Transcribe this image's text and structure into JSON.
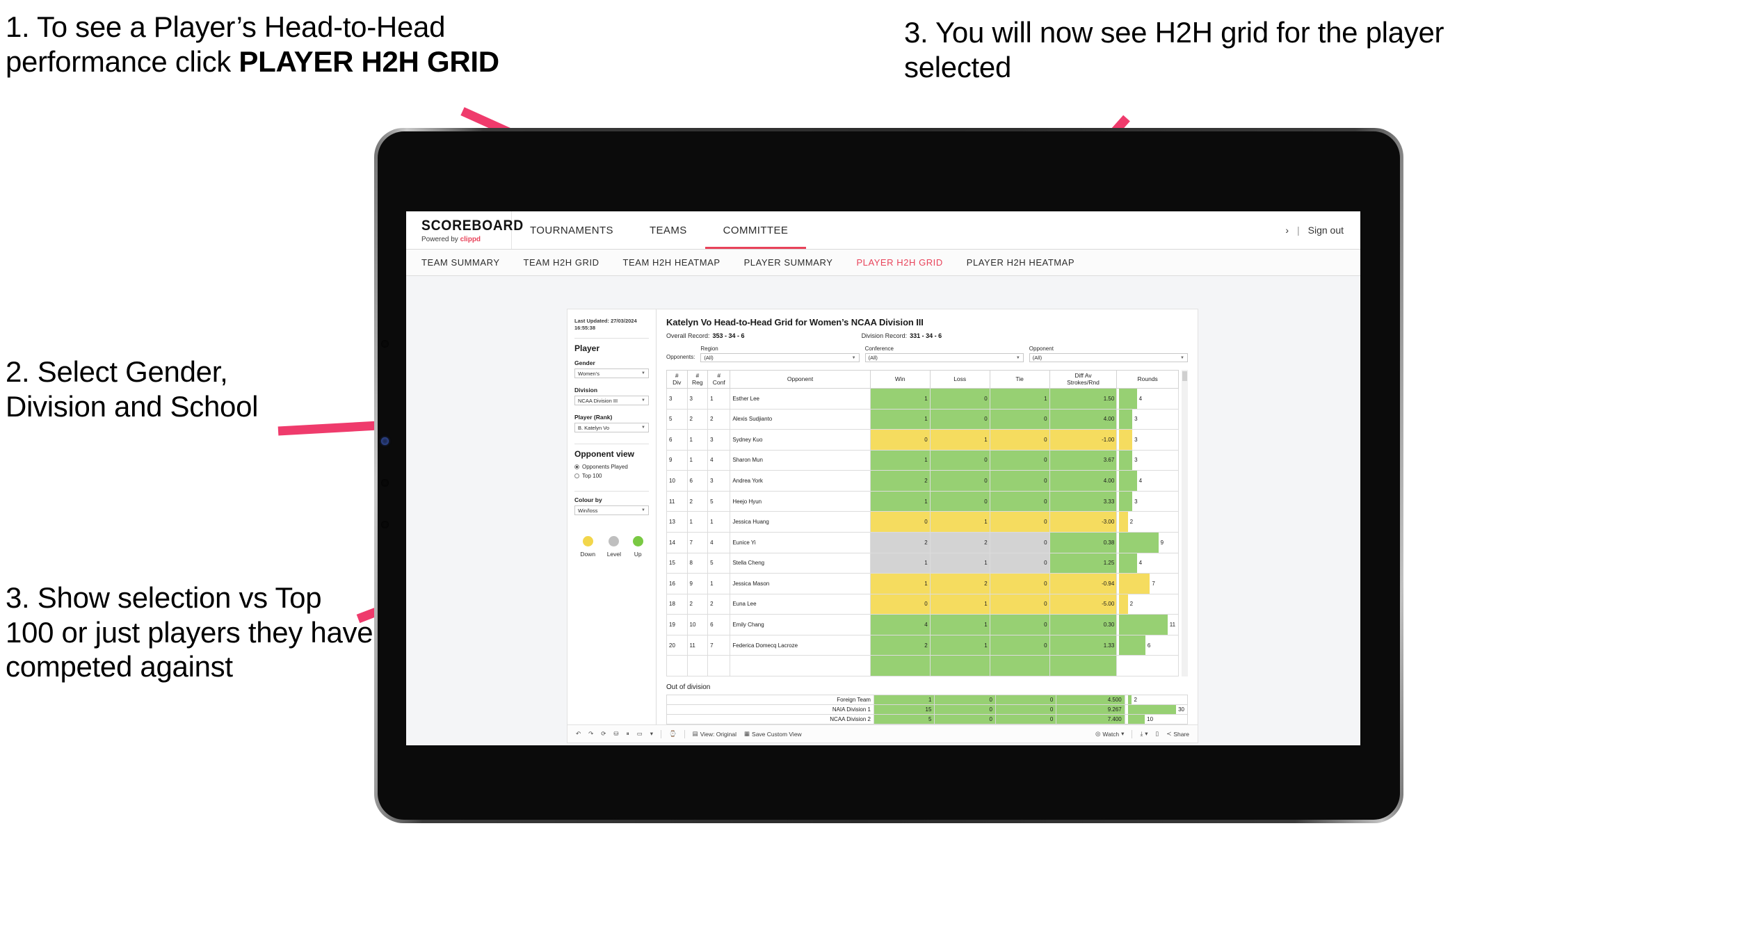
{
  "annotations": {
    "step1_prefix": "1. To see a Player’s Head-to-Head performance click ",
    "step1_bold": "PLAYER H2H GRID",
    "step2": "2. Select Gender, Division and School",
    "step3_left": "3. Show selection vs Top 100 or just players they have competed against",
    "step3_right": "3. You will now see H2H grid for the player selected",
    "arrow_color": "#ef3b6c"
  },
  "app": {
    "brand": {
      "title": "SCOREBOARD",
      "powered_prefix": "Powered by ",
      "powered_brand": "clippd"
    },
    "top_nav": [
      {
        "label": "TOURNAMENTS",
        "active": false
      },
      {
        "label": "TEAMS",
        "active": false
      },
      {
        "label": "COMMITTEE",
        "active": true
      }
    ],
    "top_right": {
      "chevron": "›",
      "separator": "|",
      "sign_out": "Sign out"
    },
    "sub_nav": [
      {
        "label": "TEAM SUMMARY",
        "active": false
      },
      {
        "label": "TEAM H2H GRID",
        "active": false
      },
      {
        "label": "TEAM H2H HEATMAP",
        "active": false
      },
      {
        "label": "PLAYER SUMMARY",
        "active": false
      },
      {
        "label": "PLAYER H2H GRID",
        "active": true
      },
      {
        "label": "PLAYER H2H HEATMAP",
        "active": false
      }
    ],
    "accent_color": "#e8435a"
  },
  "panel": {
    "last_updated": "Last Updated: 27/03/2024 16:55:38",
    "heading": "Player",
    "fields": [
      {
        "label": "Gender",
        "value": "Women’s"
      },
      {
        "label": "Division",
        "value": "NCAA Division III"
      },
      {
        "label": "Player (Rank)",
        "value": "B. Katelyn Vo"
      }
    ],
    "opponent_view": {
      "heading": "Opponent view",
      "options": [
        {
          "label": "Opponents Played",
          "selected": true
        },
        {
          "label": "Top 100",
          "selected": false
        }
      ]
    },
    "colour_by": {
      "label": "Colour by",
      "value": "Win/loss"
    },
    "legend": [
      {
        "label": "Down",
        "color": "#f2d64b"
      },
      {
        "label": "Level",
        "color": "#bfbfbf"
      },
      {
        "label": "Up",
        "color": "#7ac943"
      }
    ]
  },
  "viz": {
    "title": "Katelyn Vo Head-to-Head Grid for Women’s NCAA Division III",
    "overall_record_label": "Overall Record:",
    "overall_record_value": "353 -  34 - 6",
    "division_record_label": "Division Record:",
    "division_record_value": "331 -  34 - 6",
    "opponents_label": "Opponents:",
    "filters": [
      {
        "label": "Region",
        "value": "(All)"
      },
      {
        "label": "Conference",
        "value": "(All)"
      },
      {
        "label": "Opponent",
        "value": "(All)"
      }
    ]
  },
  "chart_data": {
    "type": "table",
    "title": "Katelyn Vo Head-to-Head Grid for Women’s NCAA Division III",
    "columns": [
      "# Div",
      "# Reg",
      "# Conf",
      "Opponent",
      "Win",
      "Loss",
      "Tie",
      "Diff Av Strokes/Rnd",
      "Rounds"
    ],
    "column_headers_two_line": [
      {
        "l1": "#",
        "l2": "Div"
      },
      {
        "l1": "#",
        "l2": "Reg"
      },
      {
        "l1": "#",
        "l2": "Conf"
      },
      {
        "l1": "Opponent",
        "l2": ""
      },
      {
        "l1": "Win",
        "l2": ""
      },
      {
        "l1": "Loss",
        "l2": ""
      },
      {
        "l1": "Tie",
        "l2": ""
      },
      {
        "l1": "Diff Av",
        "l2": "Strokes/Rnd"
      },
      {
        "l1": "Rounds",
        "l2": ""
      }
    ],
    "rows": [
      {
        "div": "3",
        "reg": "3",
        "conf": "1",
        "opponent": "Esther Lee",
        "win": "1",
        "loss": "0",
        "tie": "1",
        "diff": "1.50",
        "rounds": "4",
        "color": "g",
        "bar_pct": 31
      },
      {
        "div": "5",
        "reg": "2",
        "conf": "2",
        "opponent": "Alexis Sudjianto",
        "win": "1",
        "loss": "0",
        "tie": "0",
        "diff": "4.00",
        "rounds": "3",
        "color": "g",
        "bar_pct": 23
      },
      {
        "div": "6",
        "reg": "1",
        "conf": "3",
        "opponent": "Sydney Kuo",
        "win": "0",
        "loss": "1",
        "tie": "0",
        "diff": "-1.00",
        "rounds": "3",
        "color": "y",
        "bar_pct": 23
      },
      {
        "div": "9",
        "reg": "1",
        "conf": "4",
        "opponent": "Sharon Mun",
        "win": "1",
        "loss": "0",
        "tie": "0",
        "diff": "3.67",
        "rounds": "3",
        "color": "g",
        "bar_pct": 23
      },
      {
        "div": "10",
        "reg": "6",
        "conf": "3",
        "opponent": "Andrea York",
        "win": "2",
        "loss": "0",
        "tie": "0",
        "diff": "4.00",
        "rounds": "4",
        "color": "g",
        "bar_pct": 31
      },
      {
        "div": "11",
        "reg": "2",
        "conf": "5",
        "opponent": "Heejo Hyun",
        "win": "1",
        "loss": "0",
        "tie": "0",
        "diff": "3.33",
        "rounds": "3",
        "color": "g",
        "bar_pct": 23
      },
      {
        "div": "13",
        "reg": "1",
        "conf": "1",
        "opponent": "Jessica Huang",
        "win": "0",
        "loss": "1",
        "tie": "0",
        "diff": "-3.00",
        "rounds": "2",
        "color": "y",
        "bar_pct": 15
      },
      {
        "div": "14",
        "reg": "7",
        "conf": "4",
        "opponent": "Eunice Yi",
        "win": "2",
        "loss": "2",
        "tie": "0",
        "diff": "0.38",
        "rounds": "9",
        "color": "n",
        "diff_color": "g",
        "bar_pct": 69
      },
      {
        "div": "15",
        "reg": "8",
        "conf": "5",
        "opponent": "Stella Cheng",
        "win": "1",
        "loss": "1",
        "tie": "0",
        "diff": "1.25",
        "rounds": "4",
        "color": "n",
        "diff_color": "g",
        "bar_pct": 31
      },
      {
        "div": "16",
        "reg": "9",
        "conf": "1",
        "opponent": "Jessica Mason",
        "win": "1",
        "loss": "2",
        "tie": "0",
        "diff": "-0.94",
        "rounds": "7",
        "color": "y",
        "bar_pct": 54
      },
      {
        "div": "18",
        "reg": "2",
        "conf": "2",
        "opponent": "Euna Lee",
        "win": "0",
        "loss": "1",
        "tie": "0",
        "diff": "-5.00",
        "rounds": "2",
        "color": "y",
        "bar_pct": 15
      },
      {
        "div": "19",
        "reg": "10",
        "conf": "6",
        "opponent": "Emily Chang",
        "win": "4",
        "loss": "1",
        "tie": "0",
        "diff": "0.30",
        "rounds": "11",
        "color": "g",
        "bar_pct": 85
      },
      {
        "div": "20",
        "reg": "11",
        "conf": "7",
        "opponent": "Federica Domecq Lacroze",
        "win": "2",
        "loss": "1",
        "tie": "0",
        "diff": "1.33",
        "rounds": "6",
        "color": "g",
        "bar_pct": 46
      }
    ],
    "out_of_division": {
      "title": "Out of division",
      "rows": [
        {
          "label": "Foreign Team",
          "win": "1",
          "loss": "0",
          "tie": "0",
          "diff": "4.500",
          "rounds": "2",
          "color": "g",
          "bar_pct": 7
        },
        {
          "label": "NAIA Division 1",
          "win": "15",
          "loss": "0",
          "tie": "0",
          "diff": "9.267",
          "rounds": "30",
          "color": "g",
          "bar_pct": 90
        },
        {
          "label": "NCAA Division 2",
          "win": "5",
          "loss": "0",
          "tie": "0",
          "diff": "7.400",
          "rounds": "10",
          "color": "g",
          "bar_pct": 30
        }
      ]
    },
    "colors": {
      "up": "#97d073",
      "down": "#f5dc5f",
      "level": "#d3d3d3"
    }
  },
  "toolbar": {
    "undo_icon": "↶",
    "redo_icon": "↷",
    "revert_icon": "⟳",
    "refresh_icon": "⛁",
    "pause_icon": "⏸",
    "rect_icon": "▭",
    "caret": "▾",
    "history_icon": "⌚",
    "view_original": "View: Original",
    "save_custom_view": "Save Custom View",
    "watch": "Watch",
    "download_icon": "⤓",
    "device_icon": "▯",
    "share": "Share"
  }
}
